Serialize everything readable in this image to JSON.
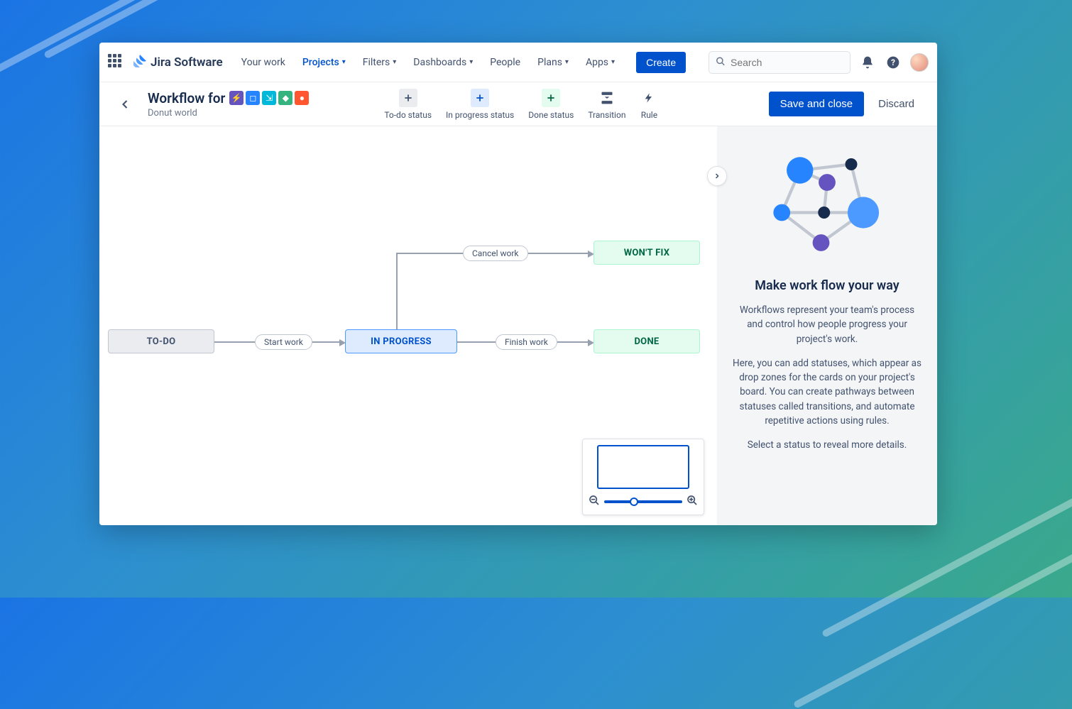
{
  "nav": {
    "product": "Jira Software",
    "items": [
      "Your work",
      "Projects",
      "Filters",
      "Dashboards",
      "People",
      "Plans",
      "Apps"
    ],
    "active_index": 1,
    "dropdown_indices": [
      1,
      2,
      3,
      5,
      6
    ],
    "create": "Create",
    "search_placeholder": "Search"
  },
  "header": {
    "title_prefix": "Workflow for",
    "project": "Donut world",
    "toolbar": {
      "todo": "To-do status",
      "inprogress": "In progress status",
      "done": "Done status",
      "transition": "Transition",
      "rule": "Rule"
    },
    "save": "Save and close",
    "discard": "Discard"
  },
  "workflow": {
    "statuses": {
      "todo": "TO-DO",
      "inprogress": "IN PROGRESS",
      "done": "DONE",
      "wontfix": "WON'T FIX"
    },
    "transitions": {
      "start": "Start work",
      "cancel": "Cancel work",
      "finish": "Finish work"
    }
  },
  "panel": {
    "title": "Make work flow your way",
    "p1": "Workflows represent your team's process and control how people progress your project's work.",
    "p2": "Here, you can add statuses, which appear as drop zones for the cards on your project's board. You can create pathways between statuses called transitions, and automate repetitive actions using rules.",
    "p3": "Select a status to reveal more details."
  }
}
